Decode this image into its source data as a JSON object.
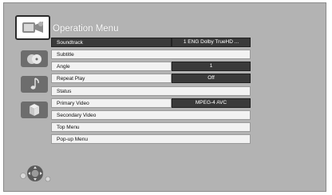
{
  "menu": {
    "title": "Operation Menu",
    "items": [
      {
        "label": "Soundtrack",
        "value": "1 ENG Dolby TrueHD  ..."
      },
      {
        "label": "Subtitle"
      },
      {
        "label": "Angle",
        "value": "1"
      },
      {
        "label": "Repeat Play",
        "value": "Off"
      },
      {
        "label": "Status"
      },
      {
        "label": "Primary Video",
        "value": "MPEG-4 AVC"
      },
      {
        "label": "Secondary Video"
      },
      {
        "label": "Top Menu"
      },
      {
        "label": "Pop-up Menu"
      }
    ]
  },
  "categories": [
    {
      "icon": "disc-player-icon",
      "active": true
    },
    {
      "icon": "disc-icon"
    },
    {
      "icon": "music-note-icon"
    },
    {
      "icon": "cube-icon"
    }
  ],
  "colors": {
    "background": "#b3b3b3",
    "selected_row": "#3a3a3a",
    "row": "#f2f2f2",
    "title_text": "#ffffff"
  }
}
